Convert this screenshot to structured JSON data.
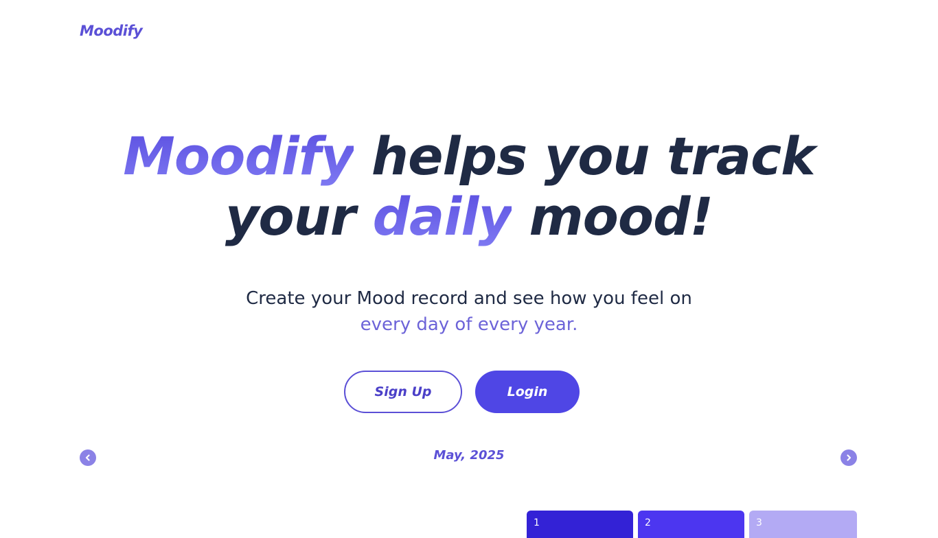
{
  "header": {
    "logo": "Moodify"
  },
  "hero": {
    "line1_accent": "Moodify",
    "line1_rest": " helps you track",
    "line2_before": "your ",
    "line2_accent": "daily",
    "line2_after": " mood!"
  },
  "subtitle": {
    "line1": "Create your Mood record and see how you feel on",
    "line2": "every day of every year."
  },
  "actions": {
    "signup_label": "Sign Up",
    "login_label": "Login"
  },
  "calendar": {
    "month_label": "May, 2025",
    "prev_icon": "chevron-left-icon",
    "next_icon": "chevron-right-icon",
    "days": [
      {
        "number": "1",
        "color": "#3322d6"
      },
      {
        "number": "2",
        "color": "#4c36f0"
      },
      {
        "number": "3",
        "color": "#b3aaf4"
      }
    ]
  },
  "colors": {
    "accent": "#5b50d6",
    "primary_button": "#4f46e5",
    "text_dark": "#1f2a44"
  }
}
